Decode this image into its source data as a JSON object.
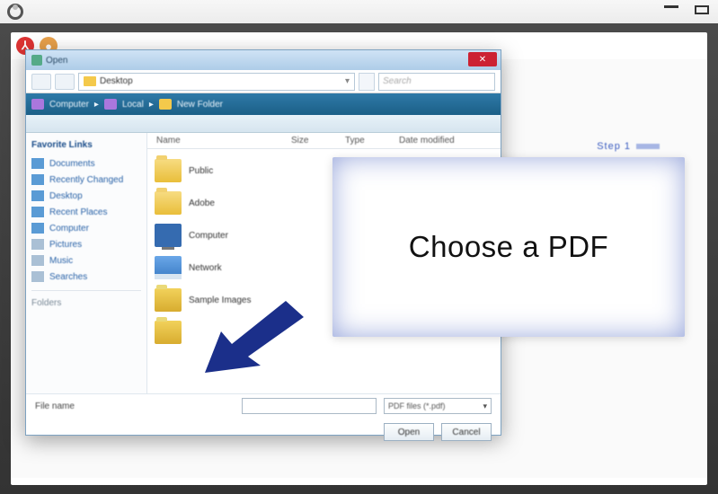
{
  "dialog": {
    "title": "Open",
    "path_current": "Desktop",
    "search_placeholder": "Search",
    "breadcrumb": [
      "Computer",
      "Local",
      "New Folder"
    ],
    "columns": [
      "Name",
      "Size",
      "Type",
      "Date modified"
    ],
    "sidebar_header": "Favorite Links",
    "sidebar_items": [
      "Documents",
      "Recently Changed",
      "Desktop",
      "Recent Places",
      "Computer",
      "Pictures",
      "Music",
      "Searches"
    ],
    "sidebar_footer": "Folders",
    "rows": [
      {
        "icon": "folder",
        "label": "Public"
      },
      {
        "icon": "folder",
        "label": "Adobe"
      },
      {
        "icon": "computer",
        "label": "Computer"
      },
      {
        "icon": "drive",
        "label": "Network"
      },
      {
        "icon": "folder2",
        "label": "Sample Images"
      },
      {
        "icon": "folder2",
        "label": ""
      }
    ],
    "filename_label": "File name",
    "file_type": "PDF files (*.pdf)",
    "open_button": "Open",
    "cancel_button": "Cancel"
  },
  "callout": {
    "text": "Choose a PDF",
    "top_label": "Step 1"
  }
}
